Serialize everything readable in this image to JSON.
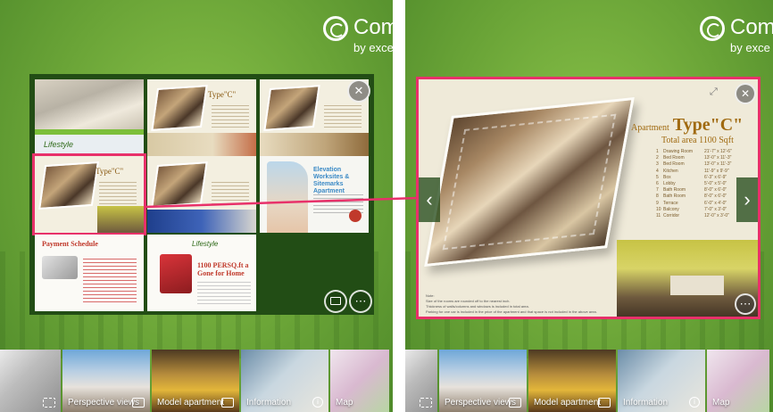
{
  "brand": {
    "name": "Comp",
    "sub": "by exce"
  },
  "viewer": {
    "title_prefix": "Apartment",
    "title_type": "Type\"C\"",
    "area_label": "Total area",
    "area": "1100 Sqft",
    "rooms": [
      {
        "n": "1",
        "room": "Drawing Room",
        "size": "21'-7\" x 12'-6\""
      },
      {
        "n": "2",
        "room": "Bed Room",
        "size": "13'-0\" x 11'-3\""
      },
      {
        "n": "3",
        "room": "Bed Room",
        "size": "13'-0\" x 11'-3\""
      },
      {
        "n": "4",
        "room": "Kitchen",
        "size": "11'-9\" x 9'-9\""
      },
      {
        "n": "5",
        "room": "Box",
        "size": "6'-3\" x 6'-9\""
      },
      {
        "n": "6",
        "room": "Lobby",
        "size": "5'-0\" x 5'-0\""
      },
      {
        "n": "7",
        "room": "Bath Room",
        "size": "8'-0\" x 6'-0\""
      },
      {
        "n": "8",
        "room": "Bath Room",
        "size": "8'-0\" x 6'-0\""
      },
      {
        "n": "9",
        "room": "Terrace",
        "size": "6'-0\" x 4'-0\""
      },
      {
        "n": "10",
        "room": "Balcony",
        "size": "7'-0\" x 3'-0\""
      },
      {
        "n": "11",
        "room": "Corridor",
        "size": "12'-0\" x 3'-0\""
      }
    ],
    "notes": "Note:\nSize of the rooms are rounded off to the nearest inch.\nThickness of walls/columns and windows is included in total area.\nParking for one car is included in the price of the apartment and that space is not included in the above area."
  },
  "grid": {
    "thumb_1_text": "Lifestyle",
    "thumb_type": "Type\"C\"",
    "thumb_payment": "Payment Schedule",
    "thumb_lifestyle": "Lifestyle",
    "thumb_gift": "1100 PERSQ.ft a Gone for Home",
    "thumb_elevation": "Elevation Worksites & Sitemarks Apartment"
  },
  "strip_left": [
    {
      "label": "",
      "icon": "dashed-frame-icon",
      "style": "t-sketch"
    },
    {
      "label": "Perspective views",
      "icon": "gallery-icon",
      "style": "t-building"
    },
    {
      "label": "Model apartment",
      "icon": "bed-icon",
      "style": "t-room"
    },
    {
      "label": "Information",
      "icon": "info-icon",
      "style": "t-info"
    },
    {
      "label": "Map",
      "icon": "",
      "style": "t-map"
    }
  ],
  "strip_right": [
    {
      "label": "",
      "icon": "dashed-frame-icon",
      "style": "t-sketch"
    },
    {
      "label": "Perspective views",
      "icon": "gallery-icon",
      "style": "t-building"
    },
    {
      "label": "Model apartment",
      "icon": "bed-icon",
      "style": "t-room"
    },
    {
      "label": "Information",
      "icon": "info-icon",
      "style": "t-info"
    },
    {
      "label": "Map",
      "icon": "",
      "style": "t-map"
    }
  ],
  "icons": {
    "close": "✕",
    "more": "⋯",
    "prev": "‹",
    "next": "›",
    "expand": "⤢",
    "info": "i"
  },
  "colors": {
    "accent": "#e8316a",
    "green": "#6aa437",
    "dark_green": "#224d15"
  }
}
